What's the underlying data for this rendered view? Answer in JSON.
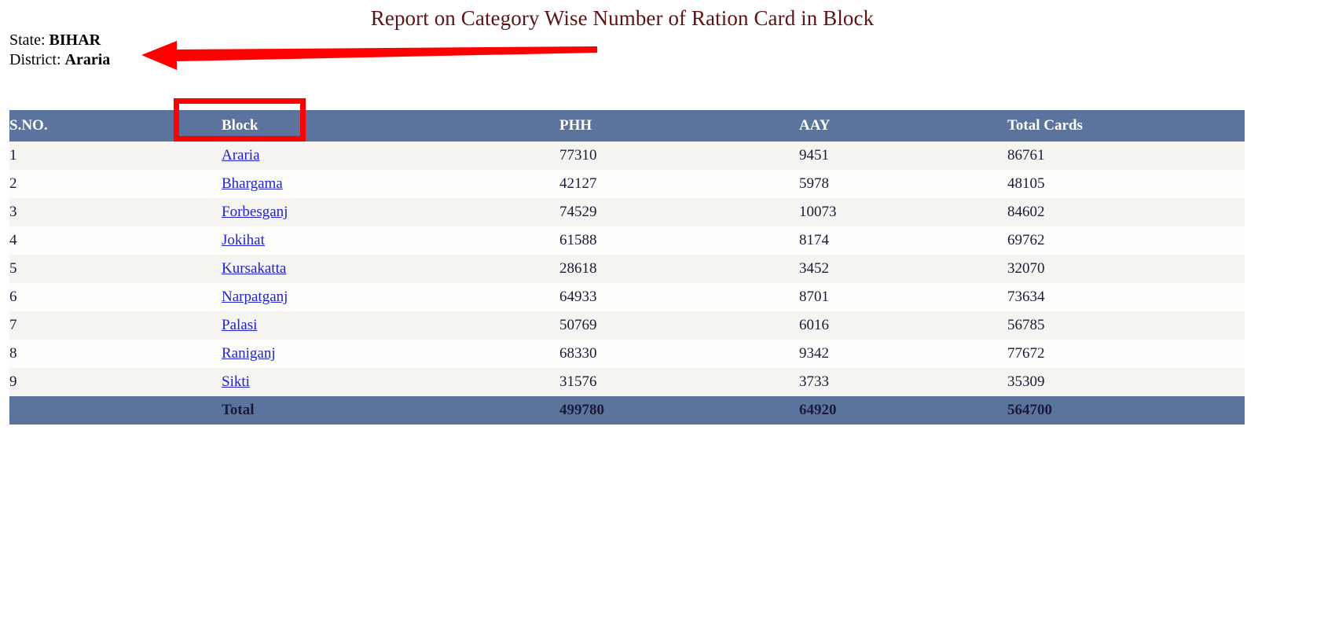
{
  "report": {
    "title": "Report on Category Wise Number of Ration Card in Block"
  },
  "meta": {
    "state_label": "State:",
    "state_value": "BIHAR",
    "district_label": "District:",
    "district_value": "Araria"
  },
  "table": {
    "headers": {
      "sno": "S.NO.",
      "block": "Block",
      "phh": "PHH",
      "aay": "AAY",
      "total_cards": "Total Cards"
    },
    "rows": [
      {
        "sno": "1",
        "block": "Araria",
        "phh": "77310",
        "aay": "9451",
        "total": "86761"
      },
      {
        "sno": "2",
        "block": "Bhargama",
        "phh": "42127",
        "aay": "5978",
        "total": "48105"
      },
      {
        "sno": "3",
        "block": "Forbesganj",
        "phh": "74529",
        "aay": "10073",
        "total": "84602"
      },
      {
        "sno": "4",
        "block": "Jokihat",
        "phh": "61588",
        "aay": "8174",
        "total": "69762"
      },
      {
        "sno": "5",
        "block": "Kursakatta",
        "phh": "28618",
        "aay": "3452",
        "total": "32070"
      },
      {
        "sno": "6",
        "block": "Narpatganj",
        "phh": "64933",
        "aay": "8701",
        "total": "73634"
      },
      {
        "sno": "7",
        "block": "Palasi",
        "phh": "50769",
        "aay": "6016",
        "total": "56785"
      },
      {
        "sno": "8",
        "block": "Raniganj",
        "phh": "68330",
        "aay": "9342",
        "total": "77672"
      },
      {
        "sno": "9",
        "block": "Sikti",
        "phh": "31576",
        "aay": "3733",
        "total": "35309"
      }
    ],
    "footer": {
      "sno": "",
      "label": "Total",
      "phh": "499780",
      "aay": "64920",
      "total": "564700"
    }
  },
  "annotations": {
    "highlight_box": {
      "target": "Block",
      "color": "#ff0000"
    },
    "arrow": {
      "direction": "left",
      "color": "#ff0000"
    }
  },
  "colors": {
    "header_bg": "#5a749e",
    "title_text": "#5d1414",
    "link": "#2222cc",
    "row_odd": "#f5f4f0",
    "row_even": "#fdfdfb",
    "annotation": "#ff0000"
  }
}
